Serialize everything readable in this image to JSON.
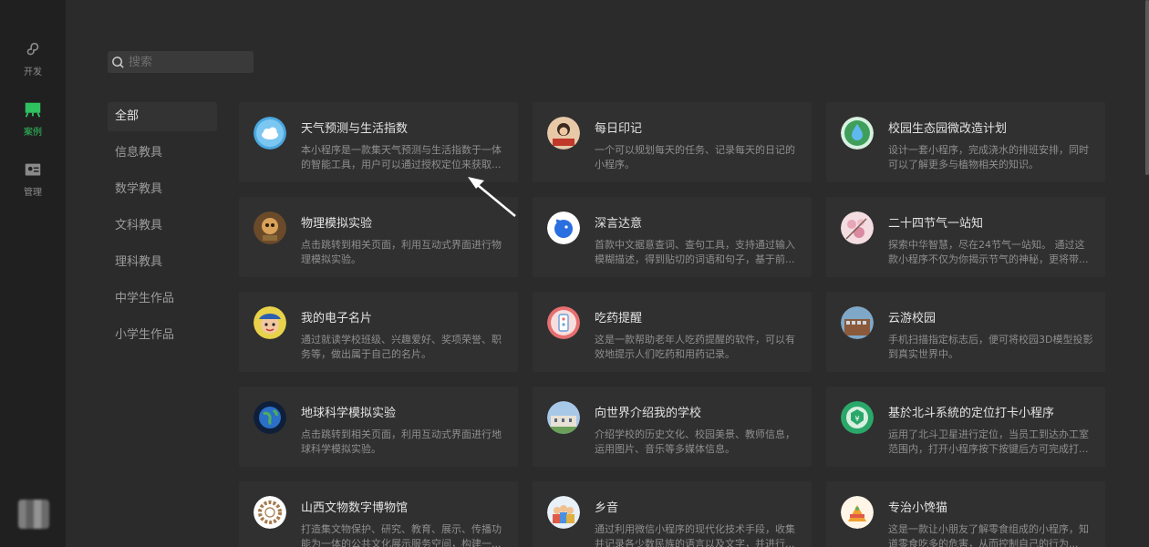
{
  "rail": {
    "items": [
      {
        "label": "开发",
        "icon": "miniprogram-icon"
      },
      {
        "label": "案例",
        "icon": "showcase-icon"
      },
      {
        "label": "管理",
        "icon": "manage-icon"
      }
    ],
    "active_color": "#2fc15f"
  },
  "search": {
    "placeholder": "搜索",
    "value": ""
  },
  "categories": [
    "全部",
    "信息教具",
    "数学教具",
    "文科教具",
    "理科教具",
    "中学生作品",
    "小学生作品"
  ],
  "cards": [
    {
      "title": "天气预测与生活指数",
      "desc": "本小程序是一款集天气预测与生活指数于一体的智能工具，用户可以通过授权定位来获取..."
    },
    {
      "title": "每日印记",
      "desc": "一个可以规划每天的任务、记录每天的日记的小程序。"
    },
    {
      "title": "校园生态园微改造计划",
      "desc": "设计一套小程序，完成浇水的排班安排，同时可以了解更多与植物相关的知识。"
    },
    {
      "title": "物理模拟实验",
      "desc": "点击跳转到相关页面，利用互动式界面进行物理模拟实验。"
    },
    {
      "title": "深言达意",
      "desc": "首款中文据意查词、查句工具，支持通过输入模糊描述，得到贴切的词语和句子，基于前..."
    },
    {
      "title": "二十四节气一站知",
      "desc": "探索中华智慧，尽在24节气一站知。 通过这款小程序不仅为你揭示节气的神秘，更将带..."
    },
    {
      "title": "我的电子名片",
      "desc": "通过就读学校班级、兴趣爱好、奖项荣誉、职务等，做出属于自己的名片。"
    },
    {
      "title": "吃药提醒",
      "desc": "这是一款帮助老年人吃药提醒的软件，可以有效地提示人们吃药和用药记录。"
    },
    {
      "title": "云游校园",
      "desc": "手机扫描指定标志后，便可将校园3D模型投影到真实世界中。"
    },
    {
      "title": "地球科学模拟实验",
      "desc": "点击跳转到相关页面，利用互动式界面进行地球科学模拟实验。"
    },
    {
      "title": "向世界介绍我的学校",
      "desc": "介绍学校的历史文化、校园美景、教师信息，运用图片、音乐等多媒体信息。"
    },
    {
      "title": "基於北斗系統的定位打卡小程序",
      "desc": "运用了北斗卫星进行定位，当员工到达办工室范围内，打开小程序按下按键后方可完成打..."
    },
    {
      "title": "山西文物数字博物馆",
      "desc": "打造集文物保护、研究、教育、展示、传播功能为一体的公共文化展示服务空间，构建一..."
    },
    {
      "title": "乡音",
      "desc": "通过利用微信小程序的现代化技术手段，收集并记录各少数民族的语言以及文字，并进行..."
    },
    {
      "title": "专治小馋猫",
      "desc": "这是一款让小朋友了解零食组成的小程序，知道零食吃多的危害，从而控制自己的行为..."
    }
  ]
}
